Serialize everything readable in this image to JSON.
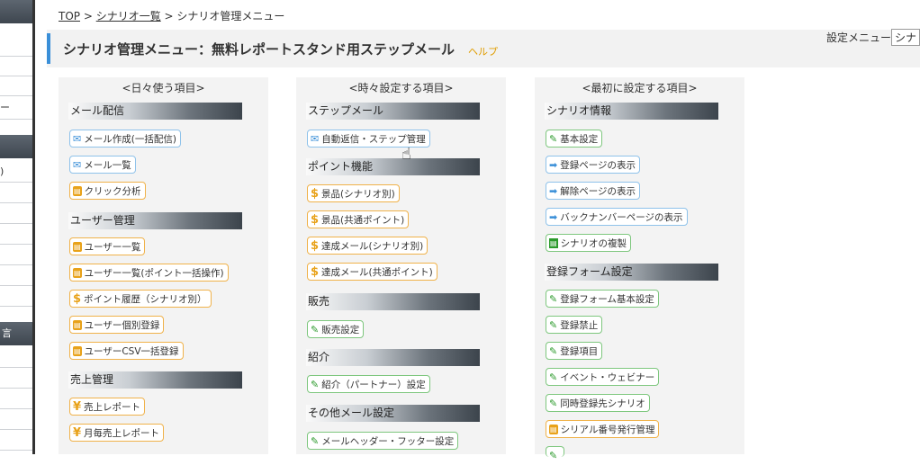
{
  "breadcrumb": {
    "top": "TOP",
    "sep1": " > ",
    "list": "シナリオ一覧",
    "sep2": " > ",
    "current": "シナリオ管理メニュー"
  },
  "header": {
    "title": "シナリオ管理メニュー：無料レポートスタンド用ステップメール",
    "help": "ヘルプ"
  },
  "settings": {
    "label": "設定メニュー",
    "select_value": "シナ"
  },
  "sidebar": {
    "snippets": [
      "ー",
      ")",
      "言"
    ]
  },
  "columns": {
    "daily": {
      "heading": "<日々使う項目>",
      "sections": {
        "mail": {
          "title": "メール配信",
          "items": [
            "メール作成(一括配信)",
            "メール一覧",
            "クリック分析"
          ]
        },
        "users": {
          "title": "ユーザー管理",
          "items": [
            "ユーザー一覧",
            "ユーザー一覧(ポイント一括操作)",
            "ポイント履歴（シナリオ別）",
            "ユーザー個別登録",
            "ユーザーCSV一括登録"
          ]
        },
        "sales": {
          "title": "売上管理",
          "items": [
            "売上レポート",
            "月毎売上レポート"
          ]
        }
      }
    },
    "occasional": {
      "heading": "<時々設定する項目>",
      "sections": {
        "step": {
          "title": "ステップメール",
          "items": [
            "自動返信・ステップ管理"
          ]
        },
        "points": {
          "title": "ポイント機能",
          "items": [
            "景品(シナリオ別)",
            "景品(共通ポイント)",
            "達成メール(シナリオ別)",
            "達成メール(共通ポイント)"
          ]
        },
        "sell": {
          "title": "販売",
          "items": [
            "販売設定"
          ]
        },
        "intro": {
          "title": "紹介",
          "items": [
            "紹介（パートナー）設定"
          ]
        },
        "other": {
          "title": "その他メール設定",
          "items": [
            "メールヘッダー・フッター設定"
          ]
        }
      }
    },
    "first": {
      "heading": "<最初に設定する項目>",
      "sections": {
        "scenario": {
          "title": "シナリオ情報",
          "items": [
            "基本設定",
            "登録ページの表示",
            "解除ページの表示",
            "バックナンバーページの表示",
            "シナリオの複製"
          ]
        },
        "form": {
          "title": "登録フォーム設定",
          "items": [
            "登録フォーム基本設定",
            "登録禁止",
            "登録項目",
            "イベント・ウェビナー",
            "同時登録先シナリオ",
            "シリアル番号発行管理"
          ]
        }
      }
    }
  },
  "colors": {
    "accent": "#3a8fd8",
    "orange": "#f0b24a",
    "green": "#7ec77e",
    "blue_border": "#8fc2ea"
  }
}
